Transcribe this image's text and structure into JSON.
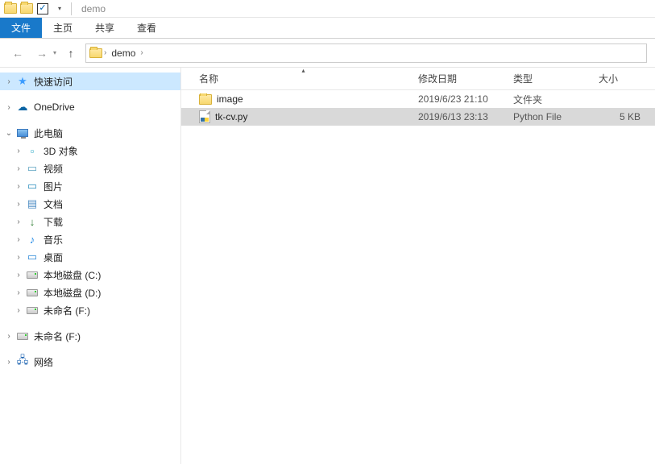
{
  "titlebar": {
    "title": "demo"
  },
  "ribbon": {
    "file": "文件",
    "tabs": [
      "主页",
      "共享",
      "查看"
    ]
  },
  "nav": {
    "crumbs": [
      "demo"
    ]
  },
  "sidebar": {
    "quick_access": "快速访问",
    "onedrive": "OneDrive",
    "this_pc": "此电脑",
    "pc_children": [
      {
        "label": "3D 对象",
        "icon": "3d"
      },
      {
        "label": "视频",
        "icon": "video"
      },
      {
        "label": "图片",
        "icon": "pic"
      },
      {
        "label": "文档",
        "icon": "doc"
      },
      {
        "label": "下载",
        "icon": "dl"
      },
      {
        "label": "音乐",
        "icon": "music"
      },
      {
        "label": "桌面",
        "icon": "desktop"
      },
      {
        "label": "本地磁盘 (C:)",
        "icon": "drive"
      },
      {
        "label": "本地磁盘 (D:)",
        "icon": "drive"
      },
      {
        "label": "未命名 (F:)",
        "icon": "drive"
      }
    ],
    "removable": "未命名 (F:)",
    "network": "网络"
  },
  "columns": {
    "name": "名称",
    "date": "修改日期",
    "type": "类型",
    "size": "大小"
  },
  "files": [
    {
      "name": "image",
      "date": "2019/6/23 21:10",
      "type": "文件夹",
      "size": "",
      "kind": "folder",
      "selected": false
    },
    {
      "name": "tk-cv.py",
      "date": "2019/6/13 23:13",
      "type": "Python File",
      "size": "5 KB",
      "kind": "py",
      "selected": true
    }
  ]
}
